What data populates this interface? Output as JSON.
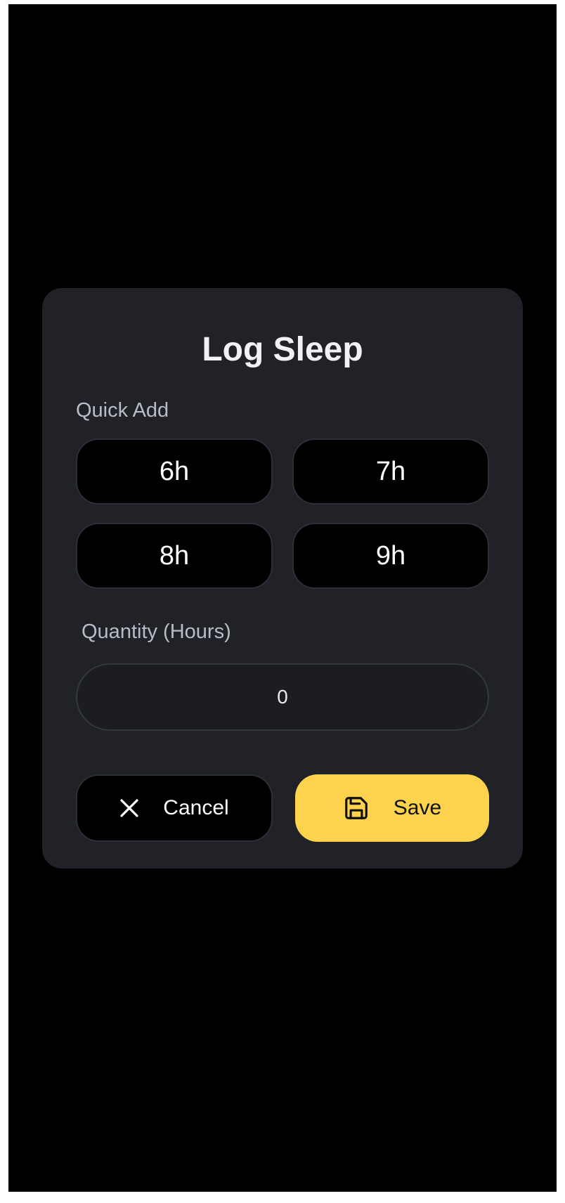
{
  "dialog": {
    "title": "Log Sleep",
    "quick_add_label": "Quick Add",
    "quick_add_options": [
      "6h",
      "7h",
      "8h",
      "9h"
    ],
    "quantity_label": "Quantity (Hours)",
    "quantity_value": "0",
    "cancel_label": "Cancel",
    "save_label": "Save"
  },
  "icons": {
    "cancel": "close-icon",
    "save": "floppy-disk-icon"
  },
  "colors": {
    "background": "#000000",
    "dialog": "#202227",
    "accent": "#fdd34d"
  }
}
